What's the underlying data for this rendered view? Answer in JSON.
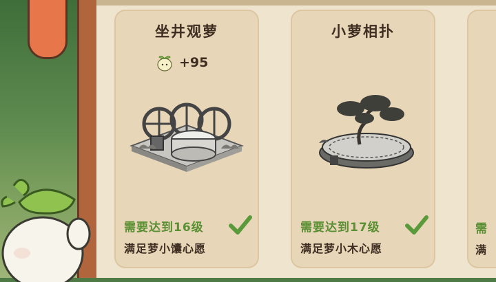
{
  "cards": [
    {
      "title": "坐井观萝",
      "reward": "+95",
      "reward_icon": "sprout-icon",
      "requirement_level": "需要达到16级",
      "requirement_wish": "满足萝小馕心愿",
      "completed": true
    },
    {
      "title": "小萝相扑",
      "requirement_level": "需要达到17级",
      "requirement_wish": "满足萝小木心愿",
      "completed": true
    },
    {
      "requirement_level": "需",
      "requirement_wish": "满"
    }
  ],
  "colors": {
    "board_bg": "#efe5cf",
    "card_bg": "#e7d6b7",
    "requirement_green": "#5b8f34",
    "text_dark": "#3f2e22",
    "check_green": "#5b9a3a"
  }
}
